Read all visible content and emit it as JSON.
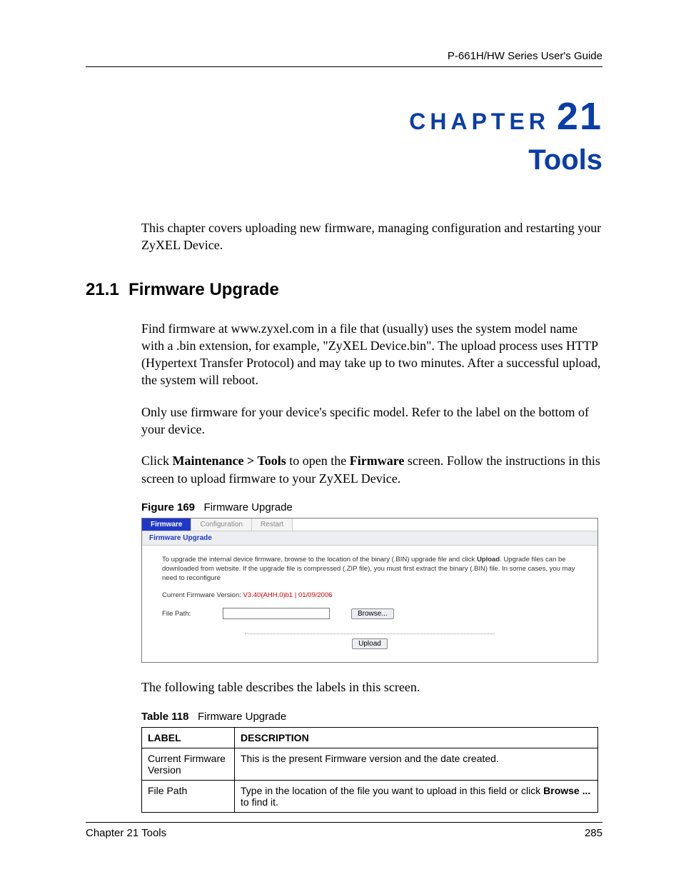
{
  "header": {
    "guide_title": "P-661H/HW Series User's Guide"
  },
  "chapter": {
    "label": "CHAPTER",
    "number": "21",
    "title": "Tools"
  },
  "intro_paragraph": "This chapter covers uploading new firmware, managing configuration and restarting your ZyXEL Device.",
  "section": {
    "number": "21.1",
    "title": "Firmware Upgrade"
  },
  "p1": "Find firmware at www.zyxel.com in a file that (usually) uses the system model name with a .bin extension, for example, \"ZyXEL Device.bin\". The upload process uses HTTP (Hypertext Transfer Protocol) and may take up to two minutes. After a successful upload, the system will reboot.",
  "p2": "Only use firmware for your device's specific model. Refer to the label on the bottom of your device.",
  "p3_pre": "Click ",
  "p3_bold1": "Maintenance > Tools",
  "p3_mid": " to open the ",
  "p3_bold2": "Firmware",
  "p3_post": " screen. Follow the instructions in this screen to upload firmware to your ZyXEL Device.",
  "figure": {
    "label": "Figure 169",
    "title": "Firmware Upgrade"
  },
  "screenshot": {
    "tabs": {
      "firmware": "Firmware",
      "configuration": "Configuration",
      "restart": "Restart"
    },
    "panel_title": "Firmware Upgrade",
    "desc_pre": "To upgrade the internal device firmware, browse to the location of the binary (.BIN) upgrade file and click ",
    "desc_bold": "Upload",
    "desc_post": ". Upgrade files can be downloaded from website. If the upgrade file is compressed (.ZIP file), you must first extract the binary (.BIN) file. In some cases, you may need to reconfigure",
    "version_label": "Current Firmware Version: ",
    "version_value": "V3.40(AHH.0)b1 | 01/09/2006",
    "file_path_label": "File Path:",
    "browse_button": "Browse...",
    "upload_button": "Upload"
  },
  "p4": "The following table describes the labels in this screen.",
  "table_caption": {
    "label": "Table 118",
    "title": "Firmware Upgrade"
  },
  "table": {
    "head_label": "LABEL",
    "head_desc": "DESCRIPTION",
    "rows": [
      {
        "label": "Current Firmware Version",
        "desc": "This is the present Firmware version and the date created."
      },
      {
        "label": "File Path",
        "desc_pre": "Type in the location of the file you want to upload in this field or click ",
        "desc_bold": "Browse ...",
        "desc_post": " to find it."
      }
    ]
  },
  "footer": {
    "left": "Chapter 21 Tools",
    "right": "285"
  }
}
